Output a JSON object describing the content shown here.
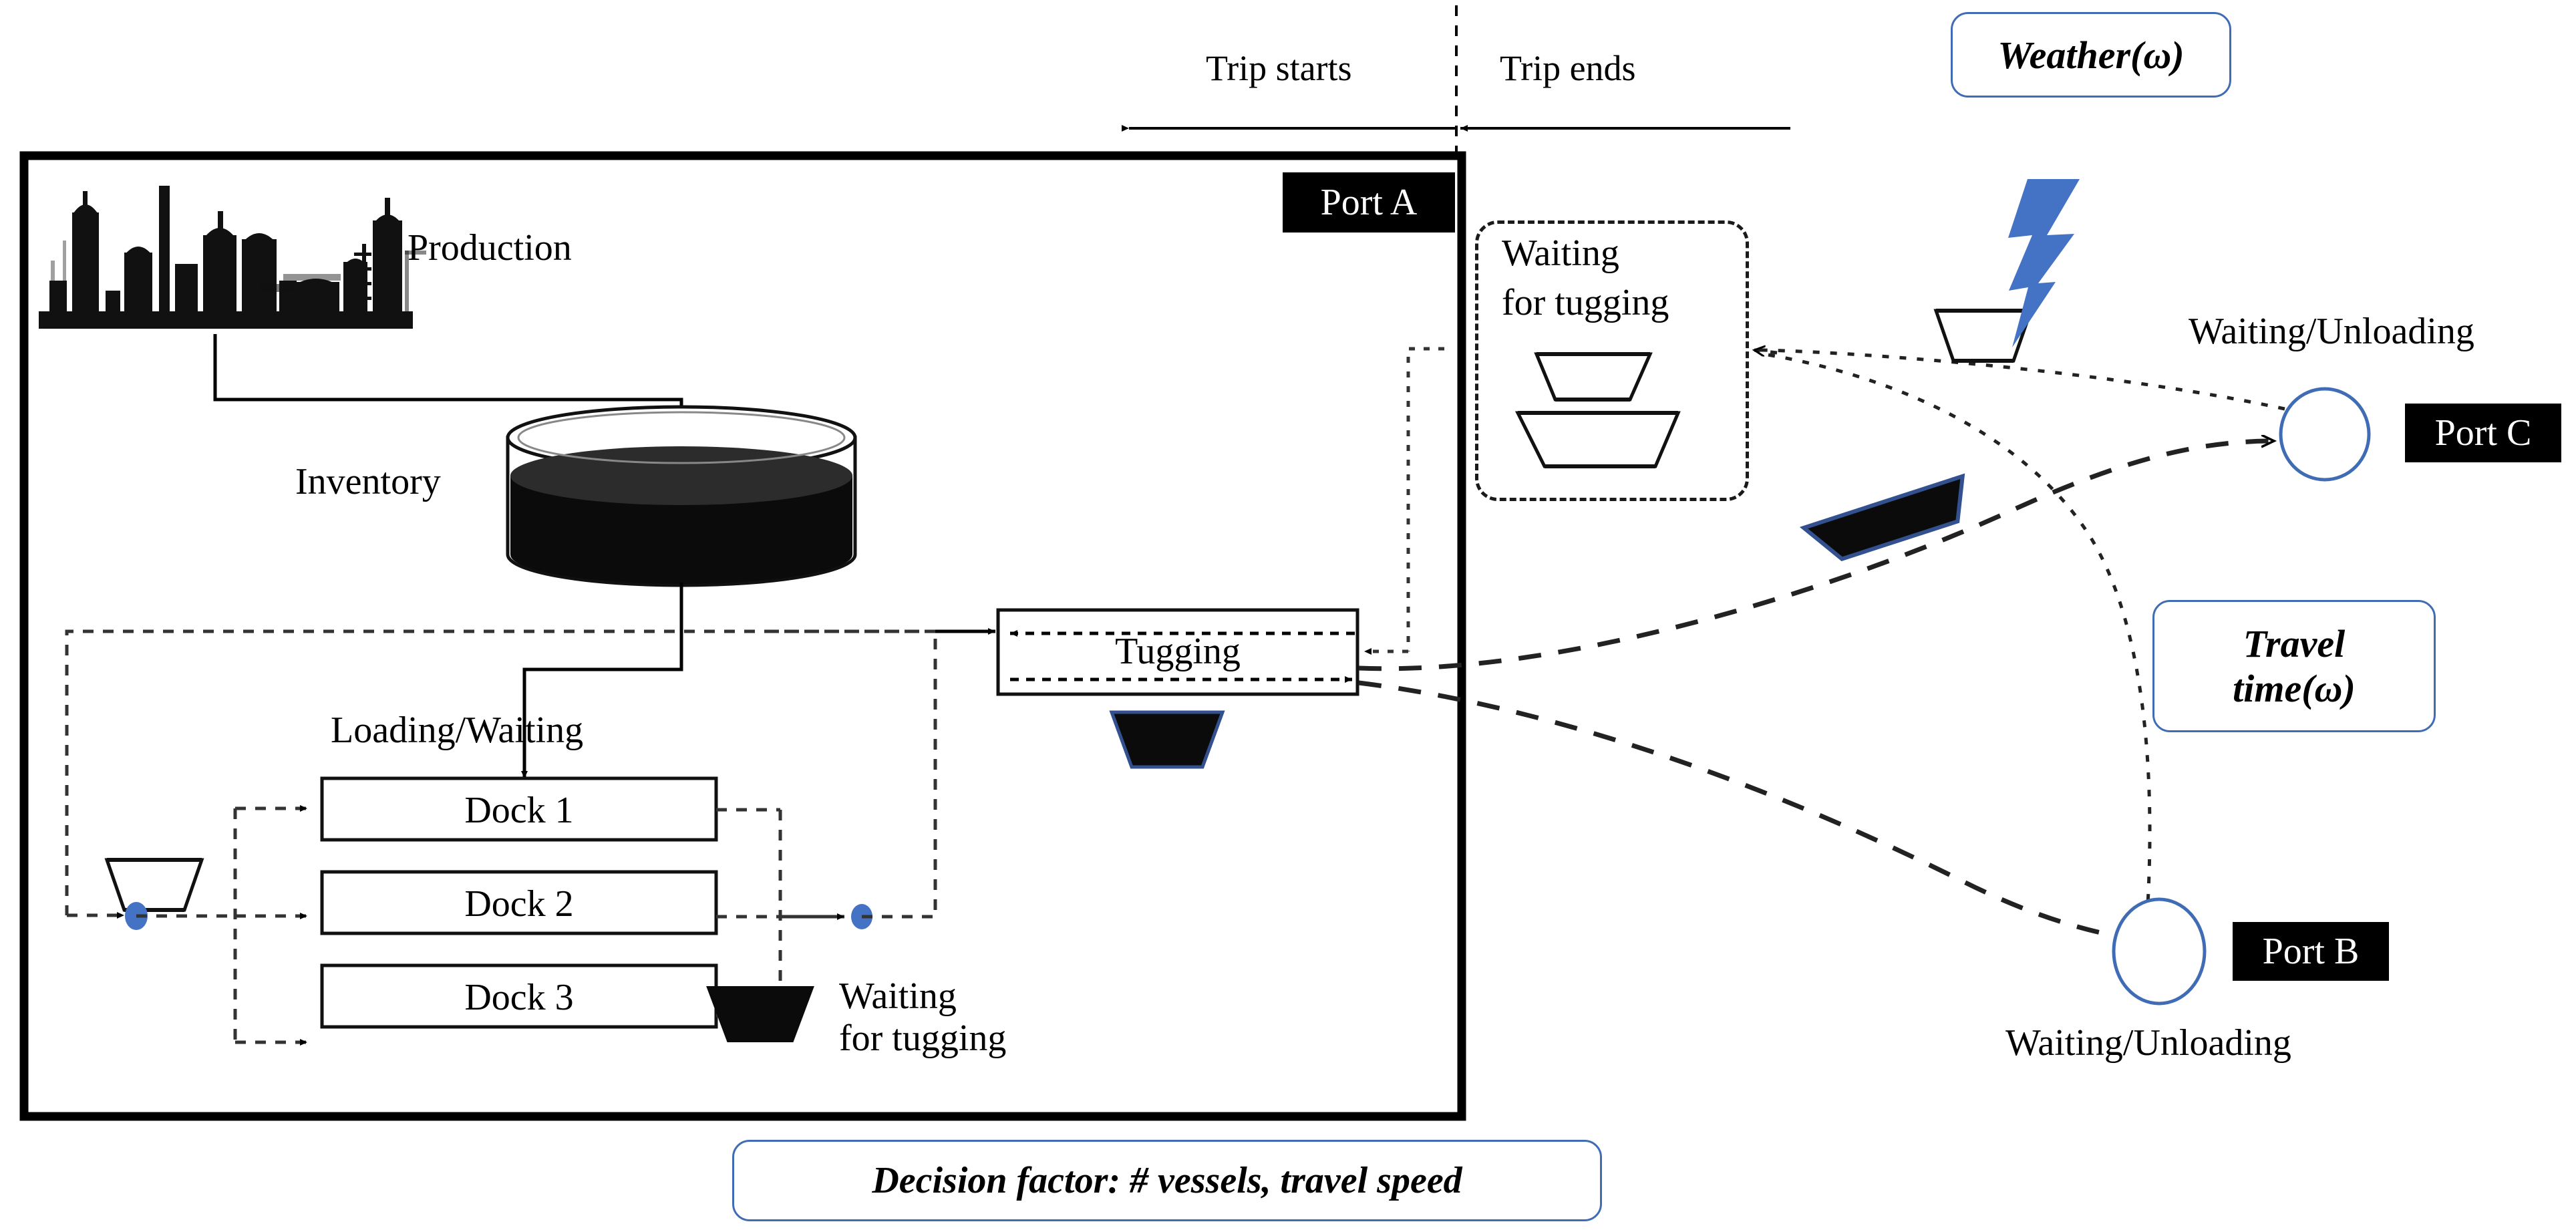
{
  "meta": {
    "title": "Maritime inventory routing process diagram",
    "type": "process-flow-diagram"
  },
  "timeline": {
    "trip_starts_label": "Trip starts",
    "trip_ends_label": "Trip ends"
  },
  "port_a": {
    "label": "Port A",
    "production_label": "Production",
    "inventory_label": "Inventory",
    "loading_waiting_label": "Loading/Waiting",
    "docks": [
      "Dock 1",
      "Dock 2",
      "Dock 3"
    ],
    "waiting_for_tugging_label": "Waiting\nfor tugging",
    "tugging_label": "Tugging"
  },
  "waiting_box": {
    "line1": "Waiting",
    "line2": "for tugging"
  },
  "ports": [
    {
      "name": "Port C",
      "status_label": "Waiting/Unloading"
    },
    {
      "name": "Port B",
      "status_label": "Waiting/Unloading"
    }
  ],
  "uncertainty": {
    "weather": "Weather(ω)",
    "travel_time_line1": "Travel",
    "travel_time_line2": "time(ω)"
  },
  "decision": {
    "text": "Decision factor: # vessels, travel speed"
  },
  "colors": {
    "accent_blue": "#3f6cb4",
    "node_blue": "#4472c4",
    "ink": "#000000",
    "paper": "#ffffff"
  },
  "icons": {
    "factory": "factory-icon",
    "tank": "storage-tank-icon",
    "vessel_empty": "vessel-empty-icon",
    "vessel_loaded": "vessel-loaded-icon",
    "lightning": "lightning-bolt-icon"
  }
}
